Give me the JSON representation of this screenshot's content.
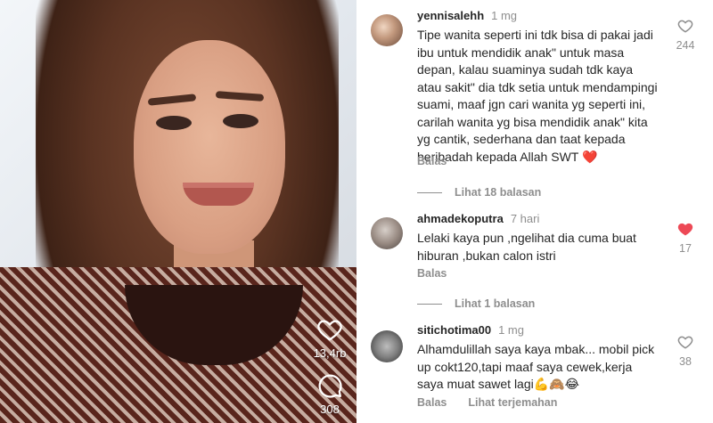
{
  "video": {
    "likes_count": "13,4rb",
    "comments_count": "308",
    "icons": {
      "like": "heart-outline-icon",
      "comment": "comment-bubble-icon"
    }
  },
  "comments": [
    {
      "username": "yennisalehh",
      "time": "1 mg",
      "text": "Tipe wanita seperti ini tdk bisa di pakai jadi ibu untuk mendidik anak\" untuk masa depan, kalau suaminya sudah tdk kaya atau sakit\" dia tdk setia untuk mendampingi suami, maaf jgn cari wanita yg seperti ini, carilah wanita yg bisa mendidik anak\" kita yg cantik, sederhana dan taat kepada beribadah kepada Allah SWT ❤️",
      "reply_label": "Balas",
      "likes": "244",
      "liked": false,
      "view_replies": "Lihat 18 balasan"
    },
    {
      "username": "ahmadekoputra",
      "time": "7 hari",
      "text": "Lelaki kaya pun ,ngelihat dia cuma buat hiburan ,bukan calon istri",
      "reply_label": "Balas",
      "likes": "17",
      "liked": true,
      "view_replies": "Lihat 1 balasan"
    },
    {
      "username": "sitichotima00",
      "time": "1 mg",
      "text": "Alhamdulillah saya kaya mbak... mobil pick up cokt120,tapi maaf saya cewek,kerja saya muat sawet lagi💪🙈😂",
      "reply_label": "Balas",
      "translate_label": "Lihat terjemahan",
      "likes": "38",
      "liked": false
    }
  ],
  "colors": {
    "text": "#262626",
    "muted": "#8e8e8e",
    "like_red": "#ed4956",
    "background": "#ffffff"
  }
}
